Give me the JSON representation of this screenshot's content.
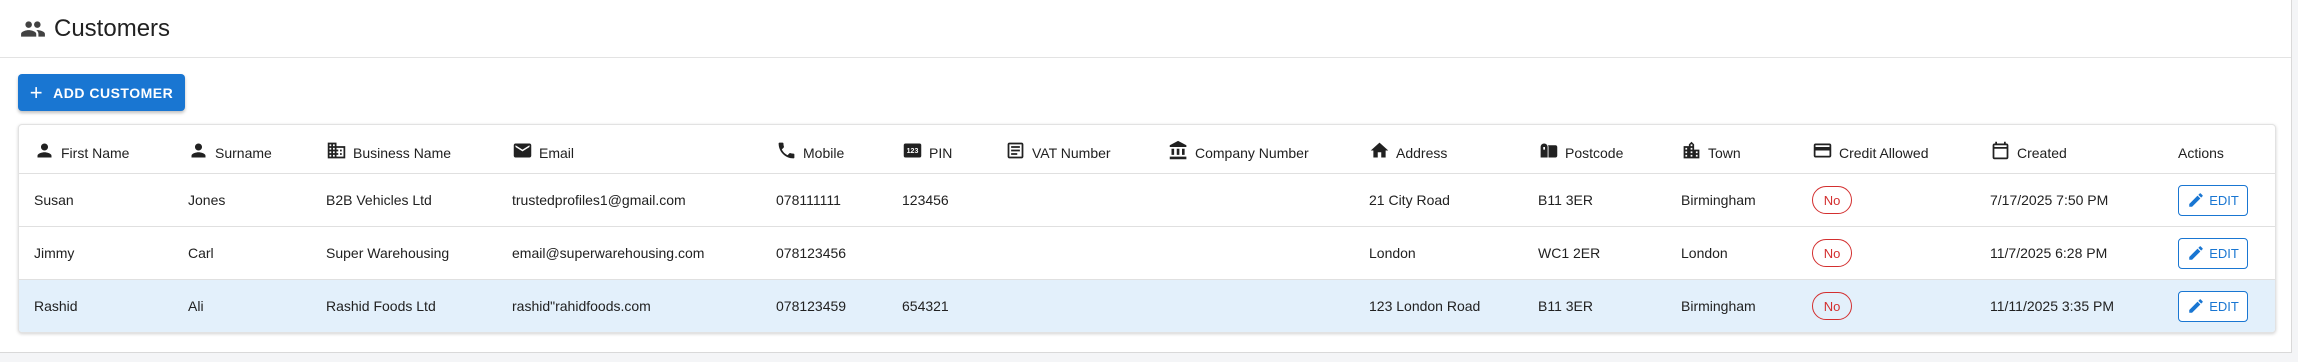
{
  "page": {
    "title": "Customers",
    "title_icon": "people-icon"
  },
  "toolbar": {
    "add_label": "ADD CUSTOMER",
    "add_icon": "plus-icon"
  },
  "table": {
    "columns": [
      {
        "label": "First Name",
        "icon": "person-icon"
      },
      {
        "label": "Surname",
        "icon": "person-icon"
      },
      {
        "label": "Business Name",
        "icon": "building-icon"
      },
      {
        "label": "Email",
        "icon": "email-icon"
      },
      {
        "label": "Mobile",
        "icon": "phone-icon"
      },
      {
        "label": "PIN",
        "icon": "pin-123-icon"
      },
      {
        "label": "VAT Number",
        "icon": "document-icon"
      },
      {
        "label": "Company Number",
        "icon": "bank-icon"
      },
      {
        "label": "Address",
        "icon": "home-icon"
      },
      {
        "label": "Postcode",
        "icon": "mailbox-icon"
      },
      {
        "label": "Town",
        "icon": "city-icon"
      },
      {
        "label": "Credit Allowed",
        "icon": "credit-card-icon"
      },
      {
        "label": "Created",
        "icon": "calendar-icon"
      },
      {
        "label": "Actions",
        "icon": ""
      }
    ],
    "rows": [
      {
        "first": "Susan",
        "surname": "Jones",
        "business": "B2B Vehicles Ltd",
        "email": "trustedprofiles1@gmail.com",
        "mobile": "078111111",
        "pin": "123456",
        "vat": "",
        "company": "",
        "address": "21 City Road",
        "postcode": "B11 3ER",
        "town": "Birmingham",
        "credit": "No",
        "created": "7/17/2025 7:50 PM",
        "action": "EDIT",
        "selected": false
      },
      {
        "first": "Jimmy",
        "surname": "Carl",
        "business": "Super Warehousing",
        "email": "email@superwarehousing.com",
        "mobile": "078123456",
        "pin": "",
        "vat": "",
        "company": "",
        "address": "London",
        "postcode": "WC1 2ER",
        "town": "London",
        "credit": "No",
        "created": "11/7/2025 6:28 PM",
        "action": "EDIT",
        "selected": false
      },
      {
        "first": "Rashid",
        "surname": "Ali",
        "business": "Rashid Foods Ltd",
        "email": "rashid\"rahidfoods.com",
        "mobile": "078123459",
        "pin": "654321",
        "vat": "",
        "company": "",
        "address": "123 London Road",
        "postcode": "B11 3ER",
        "town": "Birmingham",
        "credit": "No",
        "created": "11/11/2025 3:35 PM",
        "action": "EDIT",
        "selected": true
      }
    ]
  },
  "colors": {
    "primary": "#1976d2",
    "danger": "#d32f2f",
    "selected_row": "#e3f0fb"
  }
}
